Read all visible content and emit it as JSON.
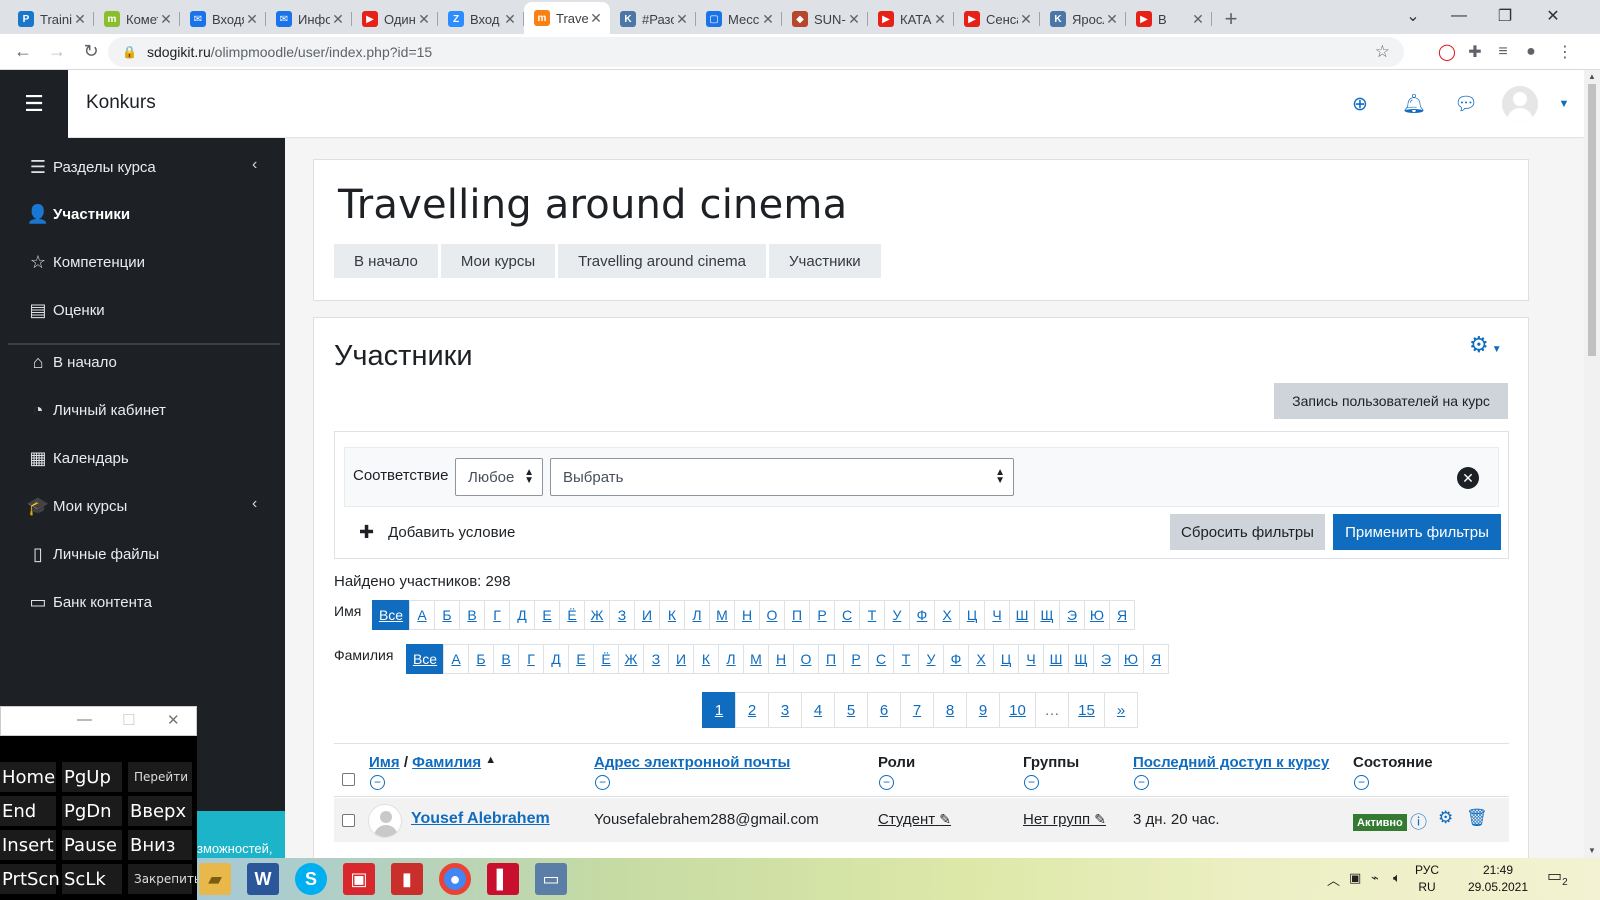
{
  "browser": {
    "tabs": [
      {
        "title": "Training",
        "icon": "pluralsight-icon",
        "color": "#1877c9",
        "glyph": "P"
      },
      {
        "title": "Комет",
        "icon": "moodle-m-icon",
        "color": "#8bbd2e",
        "glyph": "m"
      },
      {
        "title": "Входя",
        "icon": "mail-icon",
        "color": "#1a73e8",
        "glyph": "✉"
      },
      {
        "title": "Инфо",
        "icon": "mail-icon",
        "color": "#1a73e8",
        "glyph": "✉"
      },
      {
        "title": "Один",
        "icon": "youtube-icon",
        "color": "#e62117",
        "glyph": "▶"
      },
      {
        "title": "Вход",
        "icon": "zoom-icon",
        "color": "#2d8cff",
        "glyph": "Z"
      },
      {
        "title": "Travel",
        "icon": "moodle-hat-icon",
        "color": "#f98012",
        "glyph": "m"
      },
      {
        "title": "#Разо",
        "icon": "vk-icon",
        "color": "#4a76a8",
        "glyph": "K"
      },
      {
        "title": "Месс",
        "icon": "messenger-icon",
        "color": "#1a73e8",
        "glyph": "▢"
      },
      {
        "title": "SUN-",
        "icon": "crest-icon",
        "color": "#b5482c",
        "glyph": "◆"
      },
      {
        "title": "КАТА",
        "icon": "youtube-icon",
        "color": "#e62117",
        "glyph": "▶"
      },
      {
        "title": "Сенса",
        "icon": "youtube-icon",
        "color": "#e62117",
        "glyph": "▶"
      },
      {
        "title": "Яросл",
        "icon": "vk-icon",
        "color": "#4a76a8",
        "glyph": "K"
      },
      {
        "title": "В",
        "icon": "youtube-icon",
        "color": "#e62117",
        "glyph": "▶"
      }
    ],
    "url_host": "sdogikit.ru",
    "url_path": "/olimpmoodle/user/index.php?id=15"
  },
  "navbar": {
    "menu_icon": "☰",
    "site_name": "Konkurs"
  },
  "drawer": {
    "items": [
      {
        "label": "Разделы курса",
        "icon": "list-icon",
        "glyph": "☰"
      },
      {
        "label": "Участники",
        "icon": "users-icon",
        "glyph": "👤"
      },
      {
        "label": "Компетенции",
        "icon": "star-icon",
        "glyph": "☆"
      },
      {
        "label": "Оценки",
        "icon": "gradebook-icon",
        "glyph": "▤"
      },
      {
        "label": "В начало",
        "icon": "home-icon",
        "glyph": "⌂"
      },
      {
        "label": "Личный кабинет",
        "icon": "dashboard-icon",
        "glyph": "◔"
      },
      {
        "label": "Календарь",
        "icon": "calendar-icon",
        "glyph": "▦"
      },
      {
        "label": "Мои курсы",
        "icon": "graduation-cap-icon",
        "glyph": "🎓"
      },
      {
        "label": "Личные файлы",
        "icon": "file-icon",
        "glyph": "▯"
      },
      {
        "label": "Банк контента",
        "icon": "clipboard-icon",
        "glyph": "▭"
      }
    ]
  },
  "osk": {
    "keys": [
      {
        "label": "Home"
      },
      {
        "label": "PgUp"
      },
      {
        "label": "Перейти"
      },
      {
        "label": "End"
      },
      {
        "label": "PgDn"
      },
      {
        "label": "Вверх"
      },
      {
        "label": "Insert"
      },
      {
        "label": "Pause"
      },
      {
        "label": "Вниз"
      },
      {
        "label": "PrtScn"
      },
      {
        "label": "ScLk"
      },
      {
        "label": "Закрепить"
      }
    ],
    "teal_text": "зможностей,"
  },
  "header": {
    "course_title": "Travelling around cinema",
    "breadcrumb": [
      "В начало",
      "Мои курсы",
      "Travelling around cinema",
      "Участники"
    ]
  },
  "participants": {
    "heading": "Участники",
    "enrol_button": "Запись пользователей на курс",
    "filter": {
      "match_label": "Соответствие",
      "match_value": "Любое",
      "select_placeholder": "Выбрать",
      "add_condition": "Добавить условие",
      "reset": "Сбросить фильтры",
      "apply": "Применить фильтры"
    },
    "found": "Найдено участников: 298",
    "firstname_label": "Имя",
    "lastname_label": "Фамилия",
    "alphabet": [
      "Все",
      "А",
      "Б",
      "В",
      "Г",
      "Д",
      "Е",
      "Ё",
      "Ж",
      "З",
      "И",
      "К",
      "Л",
      "М",
      "Н",
      "О",
      "П",
      "Р",
      "С",
      "Т",
      "У",
      "Ф",
      "Х",
      "Ц",
      "Ч",
      "Ш",
      "Щ",
      "Э",
      "Ю",
      "Я"
    ],
    "pages": [
      "1",
      "2",
      "3",
      "4",
      "5",
      "6",
      "7",
      "8",
      "9",
      "10",
      "…",
      "15",
      "»"
    ],
    "columns": {
      "firstname": "Имя",
      "sep": "/",
      "lastname": "Фамилия",
      "email": "Адрес электронной почты",
      "roles": "Роли",
      "groups": "Группы",
      "lastaccess": "Последний доступ к курсу",
      "status": "Состояние"
    },
    "rows": [
      {
        "name": "Yousef Alebrahem",
        "email": "Yousefalebrahem288@gmail.com",
        "role": "Студент",
        "groups": "Нет групп",
        "lastaccess": "3 дн. 20 час.",
        "status": "Активно"
      }
    ]
  },
  "taskbar": {
    "lang_top": "РУС",
    "lang_bottom": "RU",
    "time": "21:49",
    "date": "29.05.2021",
    "notif_count": "2"
  }
}
